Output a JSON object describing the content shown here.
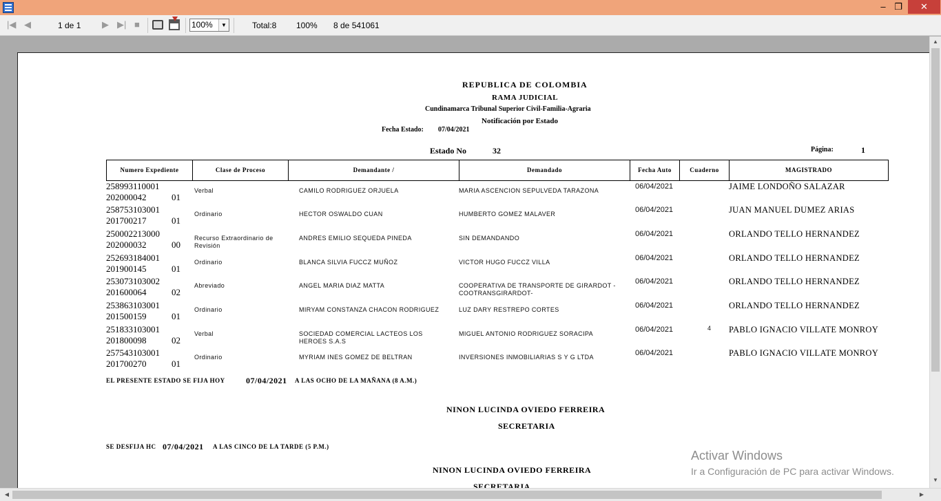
{
  "window": {
    "minimize_glyph": "–",
    "maximize_glyph": "❐",
    "close_glyph": "✕"
  },
  "toolbar": {
    "page_indicator": "1 de 1",
    "zoom_value": "100%",
    "total_label": "Total:8",
    "percent_label": "100%",
    "record_label": "8 de 541061",
    "icons": [
      "first-page-icon",
      "prev-page-icon",
      "next-page-icon",
      "last-page-icon",
      "stop-icon",
      "print-icon",
      "export-icon"
    ]
  },
  "report": {
    "header": {
      "line1": "REPUBLICA   DE   COLOMBIA",
      "line2": "RAMA   JUDICIAL",
      "line3": "Cundinamarca   Tribunal Superior   Civil-Familia-Agraria",
      "line4": "Notificación por Estado",
      "fecha_label": "Fecha Estado:",
      "fecha_value": "07/04/2021",
      "estado_label": "Estado No",
      "estado_value": "32",
      "pagina_label": "Página:",
      "pagina_value": "1"
    },
    "columns": [
      "Numero  Expediente",
      "Clase de Proceso",
      "Demandante   /",
      "Demandado",
      "Fecha  Auto",
      "Cuaderno",
      "MAGISTRADO"
    ],
    "rows": [
      {
        "exp1": "258993110001",
        "exp2": "202000042",
        "suffix": "01",
        "clase": "Verbal",
        "demandante": "CAMILO RODRIGUEZ ORJUELA",
        "demandado": "MARIA ASCENCION SEPULVEDA TARAZONA",
        "fecha": "06/04/2021",
        "cuaderno": "",
        "magistrado": "JAIME LONDOÑO SALAZAR"
      },
      {
        "exp1": "258753103001",
        "exp2": "201700217",
        "suffix": "01",
        "clase": "Ordinario",
        "demandante": "HECTOR OSWALDO CUAN",
        "demandado": "HUMBERTO GOMEZ MALAVER",
        "fecha": "06/04/2021",
        "cuaderno": "",
        "magistrado": "JUAN MANUEL DUMEZ ARIAS"
      },
      {
        "exp1": "250002213000",
        "exp2": "202000032",
        "suffix": "00",
        "clase": "Recurso Extraordinario de Revisión",
        "demandante": "ANDRES EMILIO SEQUEDA PINEDA",
        "demandado": "SIN DEMANDANDO",
        "fecha": "06/04/2021",
        "cuaderno": "",
        "magistrado": "ORLANDO TELLO HERNANDEZ"
      },
      {
        "exp1": "252693184001",
        "exp2": "201900145",
        "suffix": "01",
        "clase": "Ordinario",
        "demandante": "BLANCA SILVIA FUCCZ MUÑOZ",
        "demandado": "VICTOR HUGO FUCCZ VILLA",
        "fecha": "06/04/2021",
        "cuaderno": "",
        "magistrado": "ORLANDO TELLO HERNANDEZ"
      },
      {
        "exp1": "253073103002",
        "exp2": "201600064",
        "suffix": "02",
        "clase": "Abreviado",
        "demandante": "ANGEL MARIA DIAZ MATTA",
        "demandado": "COOPERATIVA DE TRANSPORTE DE GIRARDOT -COOTRANSGIRARDOT-",
        "fecha": "06/04/2021",
        "cuaderno": "",
        "magistrado": "ORLANDO TELLO HERNANDEZ"
      },
      {
        "exp1": "253863103001",
        "exp2": "201500159",
        "suffix": "01",
        "clase": "Ordinario",
        "demandante": "MIRYAM CONSTANZA CHACON RODRIGUEZ",
        "demandado": "LUZ DARY RESTREPO CORTES",
        "fecha": "06/04/2021",
        "cuaderno": "",
        "magistrado": "ORLANDO TELLO HERNANDEZ"
      },
      {
        "exp1": "251833103001",
        "exp2": "201800098",
        "suffix": "02",
        "clase": "Verbal",
        "demandante": "SOCIEDAD COMERCIAL LACTEOS LOS HEROES S.A.S",
        "demandado": "MIGUEL ANTONIO RODRIGUEZ SORACIPA",
        "fecha": "06/04/2021",
        "cuaderno": "4",
        "magistrado": "PABLO IGNACIO VILLATE MONROY"
      },
      {
        "exp1": "257543103001",
        "exp2": "201700270",
        "suffix": "01",
        "clase": "Ordinario",
        "demandante": "MYRIAM INES GOMEZ DE BELTRAN",
        "demandado": "INVERSIONES INMOBILIARIAS S Y G LTDA",
        "fecha": "06/04/2021",
        "cuaderno": "",
        "magistrado": "PABLO IGNACIO VILLATE MONROY"
      }
    ],
    "footer": {
      "fija_label": "EL PRESENTE ESTADO SE FIJA HOY",
      "fija_date": "07/04/2021",
      "fija_time": "A LAS OCHO DE LA MAÑANA (8 A.M.)",
      "secretary_name": "NINON LUCINDA OVIEDO FERREIRA",
      "secretary_title": "SECRETARIA",
      "desfija_label": "SE  DESFIJA HC",
      "desfija_date": "07/04/2021",
      "desfija_time": "A LAS CINCO DE LA TARDE (5 P.M.)",
      "secretary_name_2": "NINON LUCINDA OVIEDO FERREIRA",
      "secretary_title_2": "SECRETARIA"
    }
  },
  "watermark": {
    "title": "Activar Windows",
    "subtitle": "Ir a Configuración de PC para activar Windows."
  }
}
